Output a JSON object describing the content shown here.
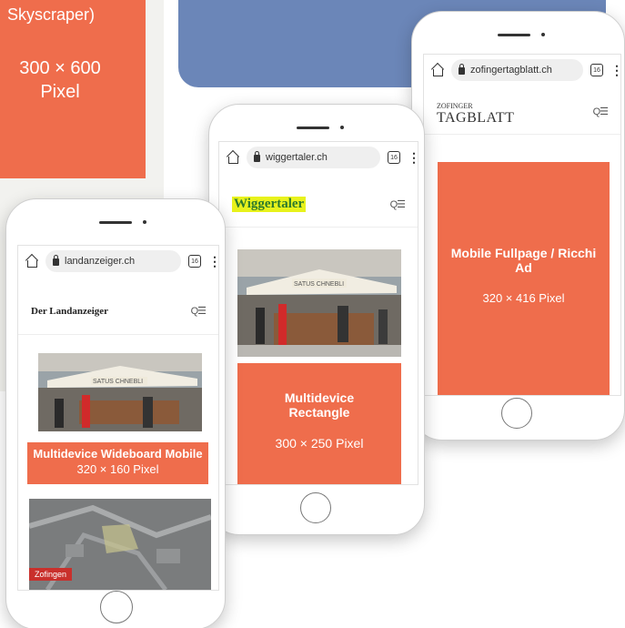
{
  "skyscraper": {
    "label_top": "Skyscraper)",
    "size": "300 × 600\nPixel"
  },
  "phone_left": {
    "url": "landanzeiger.ch",
    "tab_count": "16",
    "site_logo": "Der Landanzeiger",
    "ad_title": "Multidevice Wideboard Mobile",
    "ad_size": "320 × 160 Pixel",
    "map_tag": "Zofingen"
  },
  "phone_middle": {
    "url": "wiggertaler.ch",
    "tab_count": "16",
    "site_logo": "Wiggertaler",
    "ad_title": "Multidevice Rectangle",
    "ad_size": "300 × 250 Pixel"
  },
  "phone_right": {
    "url": "zofingertagblatt.ch",
    "tab_count": "16",
    "site_logo_top": "ZOFINGER",
    "site_logo_main": "TAGBLATT",
    "ad_title": "Mobile Fullpage / Ricchi Ad",
    "ad_size": "320 × 416 Pixel"
  },
  "photo_banner": "SATUS  CHNEBLI",
  "colors": {
    "ad": "#ef6d4c",
    "blue": "#6b86b8",
    "wiggertaler_highlight": "#e8f21c",
    "map_tag": "#c9302c"
  },
  "icons": [
    "home-icon",
    "lock-icon",
    "tabs-icon",
    "menu-icon",
    "search-menu-icon"
  ]
}
